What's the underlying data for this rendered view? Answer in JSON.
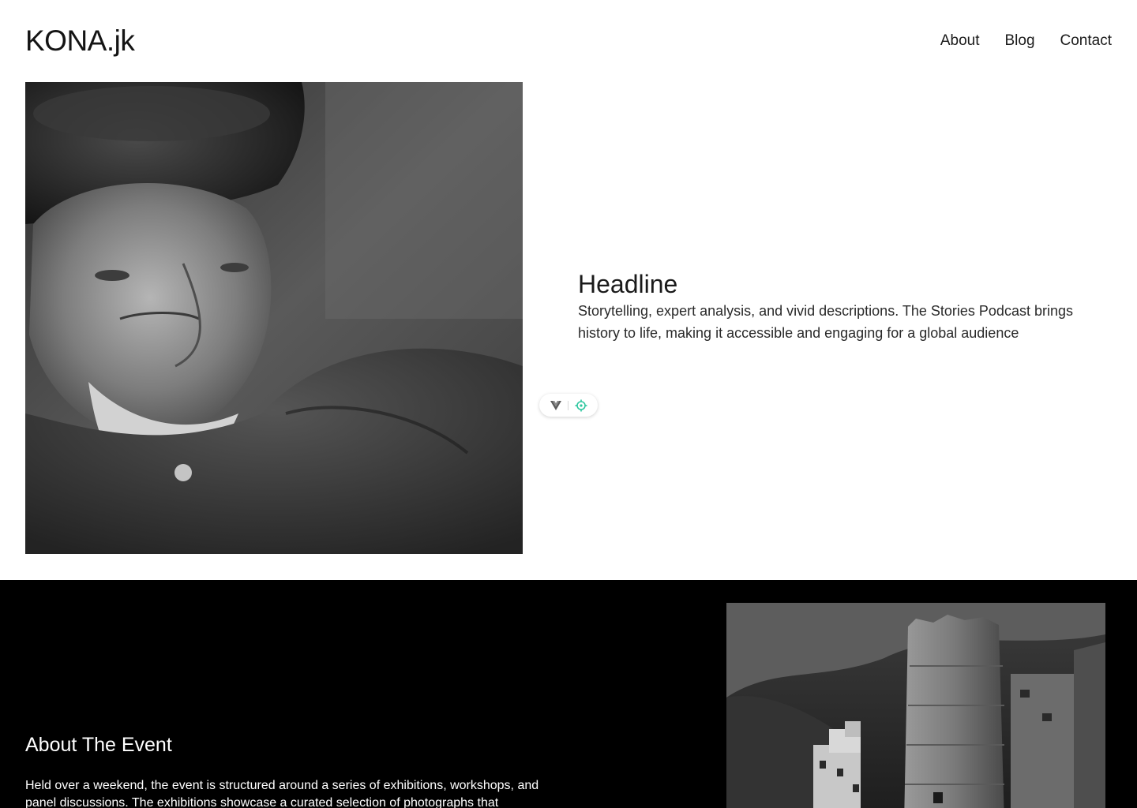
{
  "header": {
    "logo": "KONA.jk",
    "nav": [
      "About",
      "Blog",
      "Contact"
    ]
  },
  "hero": {
    "headline": "Headline",
    "description": "Storytelling, expert analysis, and vivid descriptions. The Stories Podcast brings history to life, making it accessible and engaging for a global audience",
    "image_icon": "portrait-photo"
  },
  "toolbar": {
    "icons": [
      "vue-logo-icon",
      "target-icon"
    ],
    "accent": "#2fc7a0"
  },
  "event": {
    "title": "About The Event",
    "body": "Held over a weekend, the event is structured around a series of exhibitions, workshops, and panel discussions. The exhibitions showcase a curated selection of photographs that",
    "image_icon": "cliff-dwelling-photo"
  },
  "colors": {
    "background": "#ffffff",
    "dark_section": "#000000",
    "text": "#1a1a1a"
  }
}
